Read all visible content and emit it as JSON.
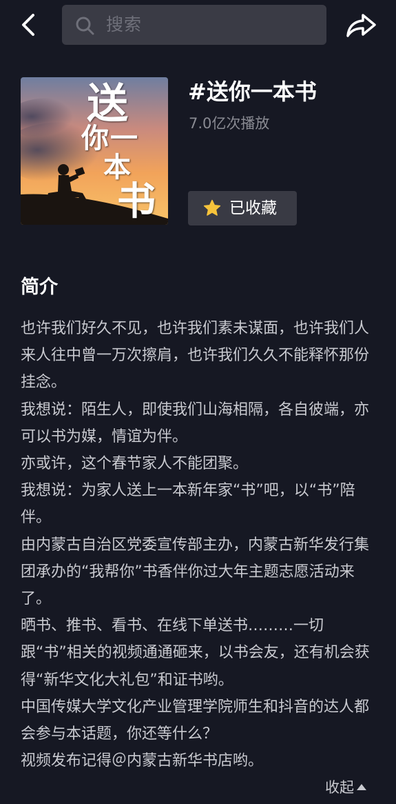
{
  "header": {
    "search_placeholder": "搜索",
    "back_icon": "chevron-left-icon",
    "share_icon": "share-arrow-icon"
  },
  "topic": {
    "title": "#送你一本书",
    "play_count": "7.0亿次播放",
    "cover_text": {
      "line1": "送",
      "line2": "你一",
      "line3": "本",
      "line4": "书"
    },
    "favorite": {
      "label": "已收藏",
      "icon": "star-icon",
      "icon_color": "#f6c33b"
    }
  },
  "intro": {
    "heading": "简介",
    "paragraphs": [
      "也许我们好久不见，也许我们素未谋面，也许我们人来人往中曾一万次擦肩，也许我们久久不能释怀那份挂念。",
      "我想说：陌生人，即使我们山海相隔，各自彼端，亦可以书为媒，情谊为伴。",
      "亦或许，这个春节家人不能团聚。",
      "我想说：为家人送上一本新年家“书”吧，以“书”陪伴。",
      "由内蒙古自治区党委宣传部主办，内蒙古新华发行集团承办的“我帮你”书香伴你过大年主题志愿活动来了。",
      "晒书、推书、看书、在线下单送书………一切跟“书”相关的视频通通砸来，以书会友，还有机会获得“新华文化大礼包”和证书哟。",
      "中国传媒大学文化产业管理学院师生和抖音的达人都会参与本话题，你还等什么？",
      "视频发布记得＠内蒙古新华书店哟。"
    ],
    "collapse_label": "收起"
  },
  "colors": {
    "background": "#161823",
    "search_bg": "#3a3b45",
    "button_bg": "#393a44",
    "secondary_text": "#8a8b93",
    "body_text": "#c8c9cf"
  }
}
